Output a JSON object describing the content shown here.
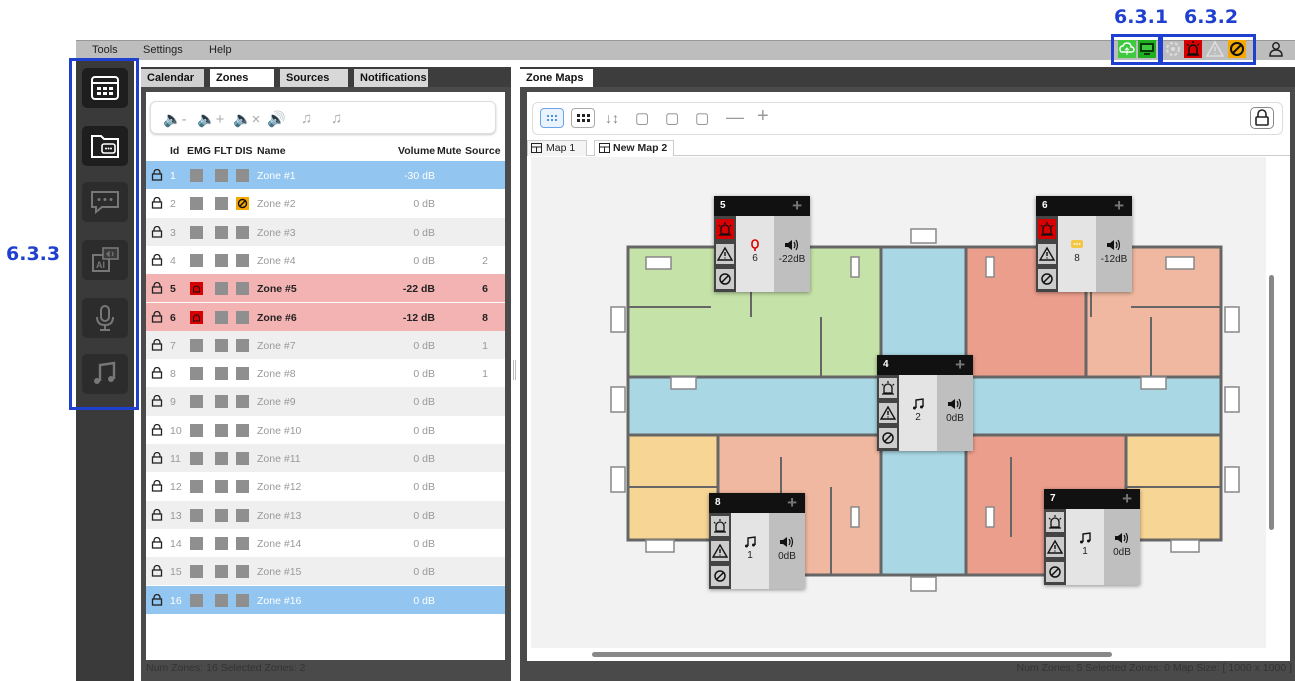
{
  "callouts": {
    "c631": "6.3.1",
    "c632": "6.3.2",
    "c633": "6.3.3"
  },
  "menu": {
    "items": [
      "Tools",
      "Settings",
      "Help"
    ]
  },
  "left_tabs": [
    "Calendar",
    "Zones",
    "Sources",
    "Notifications"
  ],
  "right_tabs": [
    "Zone Maps"
  ],
  "table": {
    "headers": {
      "id": "Id",
      "emg": "EMG",
      "flt": "FLT",
      "dis": "DIS",
      "name": "Name",
      "volume": "Volume",
      "mute": "Mute",
      "source": "Source"
    },
    "rows": [
      {
        "id": "1",
        "name": "Zone #1",
        "volume": "-30 dB",
        "source": "",
        "state": "selected",
        "emg": false,
        "dis": false
      },
      {
        "id": "2",
        "name": "Zone #2",
        "volume": "0 dB",
        "source": "",
        "state": "normal",
        "emg": false,
        "dis": true
      },
      {
        "id": "3",
        "name": "Zone #3",
        "volume": "0 dB",
        "source": "",
        "state": "alt",
        "emg": false,
        "dis": false
      },
      {
        "id": "4",
        "name": "Zone #4",
        "volume": "0 dB",
        "source": "2",
        "state": "normal",
        "emg": false,
        "dis": false
      },
      {
        "id": "5",
        "name": "Zone #5",
        "volume": "-22 dB",
        "source": "6",
        "state": "emergency",
        "emg": true,
        "dis": false
      },
      {
        "id": "6",
        "name": "Zone #6",
        "volume": "-12 dB",
        "source": "8",
        "state": "emergency",
        "emg": true,
        "dis": false
      },
      {
        "id": "7",
        "name": "Zone #7",
        "volume": "0 dB",
        "source": "1",
        "state": "alt",
        "emg": false,
        "dis": false
      },
      {
        "id": "8",
        "name": "Zone #8",
        "volume": "0 dB",
        "source": "1",
        "state": "normal",
        "emg": false,
        "dis": false
      },
      {
        "id": "9",
        "name": "Zone #9",
        "volume": "0 dB",
        "source": "",
        "state": "alt",
        "emg": false,
        "dis": false
      },
      {
        "id": "10",
        "name": "Zone #10",
        "volume": "0 dB",
        "source": "",
        "state": "normal",
        "emg": false,
        "dis": false
      },
      {
        "id": "11",
        "name": "Zone #11",
        "volume": "0 dB",
        "source": "",
        "state": "alt",
        "emg": false,
        "dis": false
      },
      {
        "id": "12",
        "name": "Zone #12",
        "volume": "0 dB",
        "source": "",
        "state": "normal",
        "emg": false,
        "dis": false
      },
      {
        "id": "13",
        "name": "Zone #13",
        "volume": "0 dB",
        "source": "",
        "state": "alt",
        "emg": false,
        "dis": false
      },
      {
        "id": "14",
        "name": "Zone #14",
        "volume": "0 dB",
        "source": "",
        "state": "normal",
        "emg": false,
        "dis": false
      },
      {
        "id": "15",
        "name": "Zone #15",
        "volume": "0 dB",
        "source": "",
        "state": "alt",
        "emg": false,
        "dis": false
      },
      {
        "id": "16",
        "name": "Zone #16",
        "volume": "0 dB",
        "source": "",
        "state": "selected",
        "emg": false,
        "dis": false
      }
    ]
  },
  "status_left": "Num Zones: 16  Selected Zones: 2",
  "map_tabs": [
    "Map 1",
    "New Map 2"
  ],
  "status_right": "Num Zones: 5  Selected Zones: 0  Map Size: [ 1000 x 1000 ]",
  "zone_cards": [
    {
      "num": "5",
      "mid": "6",
      "vol": "-22dB",
      "emg": true
    },
    {
      "num": "6",
      "mid": "8",
      "vol": "-12dB",
      "emg": true
    },
    {
      "num": "4",
      "mid": "2",
      "vol": "0dB",
      "emg": false
    },
    {
      "num": "8",
      "mid": "1",
      "vol": "0dB",
      "emg": false
    },
    {
      "num": "7",
      "mid": "1",
      "vol": "0dB",
      "emg": false
    }
  ],
  "colors": {
    "selected": "#92c5f0",
    "emergency": "#f4b3b3",
    "alt": "#efefef",
    "emg_red": "#d60000",
    "dis_orange": "#f5a800",
    "status_green": "#3ec93e",
    "accent_blue": "#1f3fd0"
  }
}
